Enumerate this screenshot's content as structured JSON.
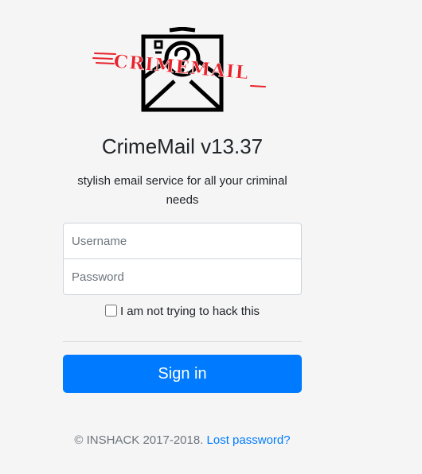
{
  "brand": {
    "logo_icon": "envelope-question-icon",
    "logo_stamp_text": "CRIMEMAIL",
    "stamp_color": "#e8232c"
  },
  "title": "CrimeMail v13.37",
  "subtitle": "stylish email service for all your criminal needs",
  "form": {
    "username_placeholder": "Username",
    "password_placeholder": "Password",
    "checkbox_label": "I am not trying to hack this",
    "checkbox_checked": false,
    "signin_label": "Sign in"
  },
  "footer": {
    "copyright": "© INSHACK 2017-2018.",
    "lost_password_label": "Lost password?"
  },
  "colors": {
    "background": "#f5f5f5",
    "primary": "#007bff",
    "text": "#212529",
    "muted": "#6c757d"
  }
}
